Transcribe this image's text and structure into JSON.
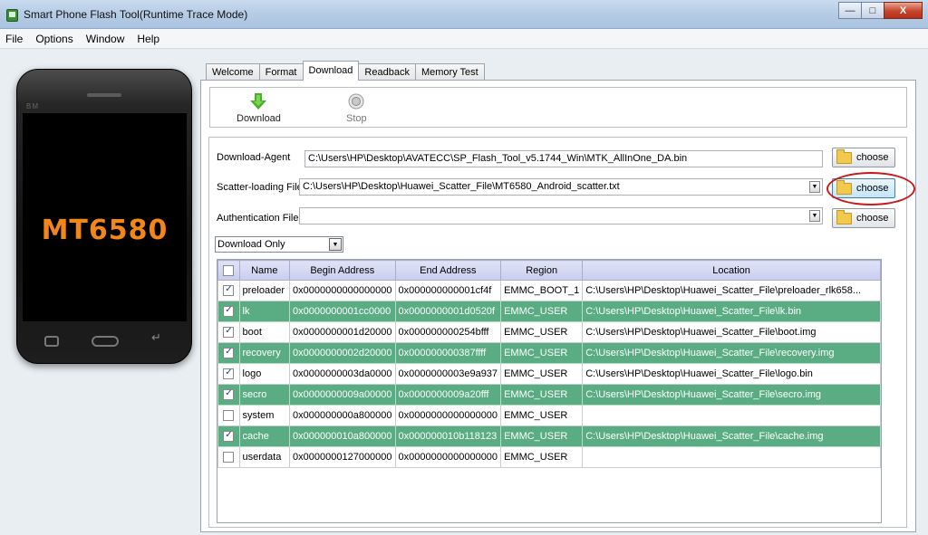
{
  "window": {
    "title": "Smart Phone Flash Tool(Runtime Trace Mode)",
    "minimize": "—",
    "maximize": "□",
    "close": "X"
  },
  "menu": [
    "File",
    "Options",
    "Window",
    "Help"
  ],
  "phone": {
    "brand": "BM",
    "model": "MT6580"
  },
  "tabs": [
    "Welcome",
    "Format",
    "Download",
    "Readback",
    "Memory Test"
  ],
  "active_tab": "Download",
  "toolbar": {
    "download": "Download",
    "stop": "Stop"
  },
  "form": {
    "download_agent": {
      "label": "Download-Agent",
      "value": "C:\\Users\\HP\\Desktop\\AVATECC\\SP_Flash_Tool_v5.1744_Win\\MTK_AllInOne_DA.bin",
      "button": "choose"
    },
    "scatter_file": {
      "label": "Scatter-loading File",
      "value": "C:\\Users\\HP\\Desktop\\Huawei_Scatter_File\\MT6580_Android_scatter.txt",
      "button": "choose"
    },
    "auth_file": {
      "label": "Authentication File",
      "value": "",
      "button": "choose"
    },
    "mode": "Download Only"
  },
  "table": {
    "headers": [
      "Name",
      "Begin Address",
      "End Address",
      "Region",
      "Location"
    ],
    "rows": [
      {
        "checked": true,
        "name": "preloader",
        "begin": "0x0000000000000000",
        "end": "0x000000000001cf4f",
        "region": "EMMC_BOOT_1",
        "location": "C:\\Users\\HP\\Desktop\\Huawei_Scatter_File\\preloader_rlk658...",
        "selected": false
      },
      {
        "checked": true,
        "name": "lk",
        "begin": "0x0000000001cc0000",
        "end": "0x0000000001d0520f",
        "region": "EMMC_USER",
        "location": "C:\\Users\\HP\\Desktop\\Huawei_Scatter_File\\lk.bin",
        "selected": true
      },
      {
        "checked": true,
        "name": "boot",
        "begin": "0x0000000001d20000",
        "end": "0x000000000254bfff",
        "region": "EMMC_USER",
        "location": "C:\\Users\\HP\\Desktop\\Huawei_Scatter_File\\boot.img",
        "selected": false
      },
      {
        "checked": true,
        "name": "recovery",
        "begin": "0x0000000002d20000",
        "end": "0x000000000387ffff",
        "region": "EMMC_USER",
        "location": "C:\\Users\\HP\\Desktop\\Huawei_Scatter_File\\recovery.img",
        "selected": true
      },
      {
        "checked": true,
        "name": "logo",
        "begin": "0x0000000003da0000",
        "end": "0x0000000003e9a937",
        "region": "EMMC_USER",
        "location": "C:\\Users\\HP\\Desktop\\Huawei_Scatter_File\\logo.bin",
        "selected": false
      },
      {
        "checked": true,
        "name": "secro",
        "begin": "0x0000000009a00000",
        "end": "0x0000000009a20fff",
        "region": "EMMC_USER",
        "location": "C:\\Users\\HP\\Desktop\\Huawei_Scatter_File\\secro.img",
        "selected": true
      },
      {
        "checked": false,
        "name": "system",
        "begin": "0x000000000a800000",
        "end": "0x0000000000000000",
        "region": "EMMC_USER",
        "location": "",
        "selected": false
      },
      {
        "checked": true,
        "name": "cache",
        "begin": "0x000000010a800000",
        "end": "0x000000010b118123",
        "region": "EMMC_USER",
        "location": "C:\\Users\\HP\\Desktop\\Huawei_Scatter_File\\cache.img",
        "selected": true
      },
      {
        "checked": false,
        "name": "userdata",
        "begin": "0x0000000127000000",
        "end": "0x0000000000000000",
        "region": "EMMC_USER",
        "location": "",
        "selected": false
      }
    ]
  },
  "colors": {
    "selected_row": "#5aad82",
    "highlight_ring": "#c81a1a"
  }
}
